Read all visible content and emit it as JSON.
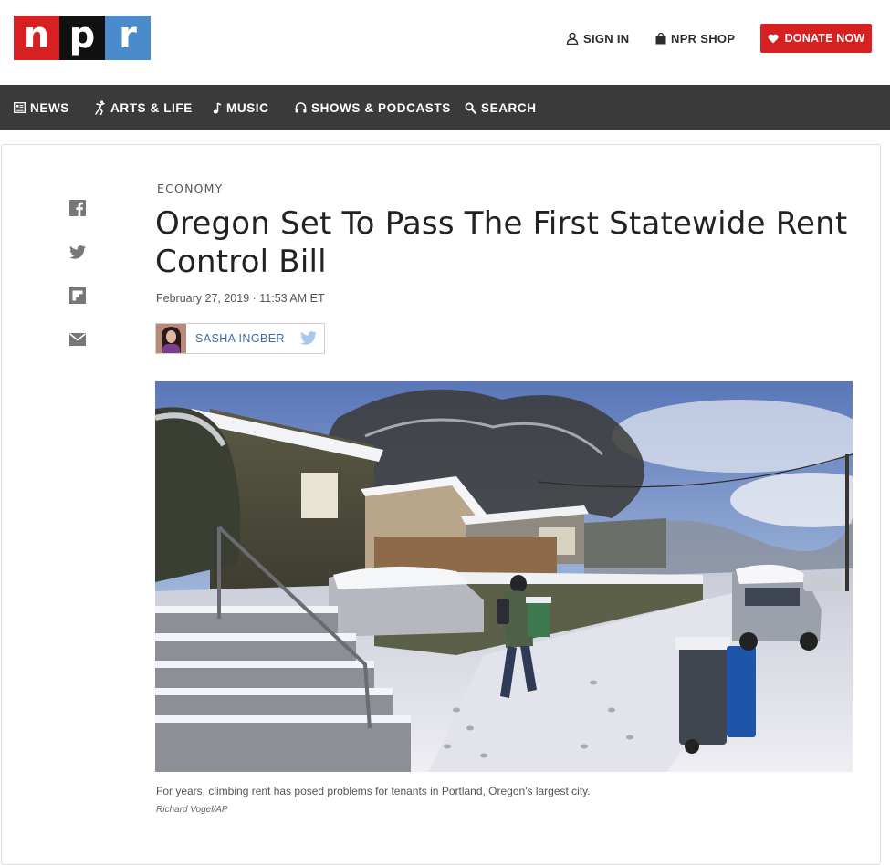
{
  "logo": {
    "letters": [
      "n",
      "p",
      "r"
    ]
  },
  "utility": {
    "sign_in": "SIGN IN",
    "shop": "NPR SHOP",
    "donate": "DONATE NOW"
  },
  "nav": [
    {
      "label": "NEWS",
      "icon": "newspaper-icon"
    },
    {
      "label": "ARTS & LIFE",
      "icon": "dancer-icon"
    },
    {
      "label": "MUSIC",
      "icon": "music-note-icon"
    },
    {
      "label": "SHOWS & PODCASTS",
      "icon": "headphones-icon"
    },
    {
      "label": "SEARCH",
      "icon": "search-icon"
    }
  ],
  "share": [
    "facebook-icon",
    "twitter-icon",
    "flipboard-icon",
    "email-icon"
  ],
  "article": {
    "slug": "ECONOMY",
    "title": "Oregon Set To Pass The First Statewide Rent Control Bill",
    "date": "February 27, 2019 · 11:53 AM ET",
    "author": "SASHA INGBER",
    "caption": "For years, climbing rent has posed problems for tenants in Portland, Oregon's largest city.",
    "credit": "Richard Vogel/AP"
  },
  "colors": {
    "npr_red": "#d62021",
    "npr_black": "#111111",
    "npr_blue": "#4a8bcc",
    "nav_bg": "#3a3a3a",
    "link_blue": "#3b6ea8"
  }
}
